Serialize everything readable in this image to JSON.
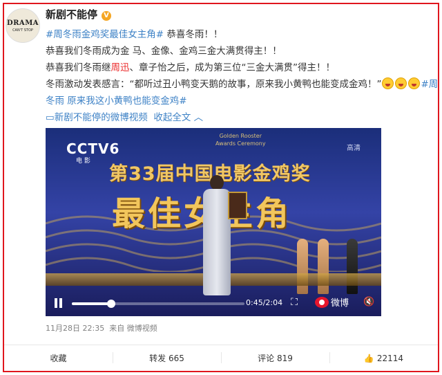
{
  "account": {
    "name": "新剧不能停",
    "verified_icon": "v-badge-icon",
    "avatar_line1": "DRAMA",
    "avatar_line2": "CAN'T STOP"
  },
  "post": {
    "hashtag": "#周冬雨金鸡奖最佳女主角#",
    "line1_rest": " 恭喜冬雨！！",
    "line2": "恭喜我们冬雨成为金 马、金像、金鸡三金大满贯得主！！",
    "line3_pre": "恭喜我们冬雨继",
    "line3_highlight": "周迅",
    "line3_post": "、章子怡之后，成为第三位“三金大满贯”得主！！",
    "line4": "冬雨激动发表感言：“都听过丑小鸭变天鹅的故事，原来我小黄鸭也能变成金鸡！”",
    "line4_tail": "#周",
    "line5": "冬雨 原来我这小黄鸭也能变金鸡#",
    "source_link": "新剧不能停的微博视频",
    "collapse_link": "收起全文",
    "emoji_icon": "grin-emoji-icon"
  },
  "video": {
    "channel": "CCTV6",
    "channel_sub": "电 影",
    "event_en_1": "Golden Rooster",
    "event_en_2": "Awards Ceremony",
    "quality": "高清",
    "title_line1": "第33届中国电影金鸡奖",
    "title_line2": "最佳女主角",
    "progress_fraction": 0.226,
    "time_current": "0:45",
    "time_total": "2:04",
    "time_display": "0:45/2:04",
    "watermark": "微博",
    "play_icon": "pause-icon",
    "fullscreen_icon": "fullscreen-icon",
    "mute_icon": "mute-icon"
  },
  "meta": {
    "timestamp": "11月28日 22:35",
    "source": "来自 微博视频"
  },
  "actions": {
    "favorite": "收藏",
    "repost": "转发 665",
    "comment": "评论 819",
    "like": "22114",
    "like_icon": "thumbs-up-icon"
  }
}
